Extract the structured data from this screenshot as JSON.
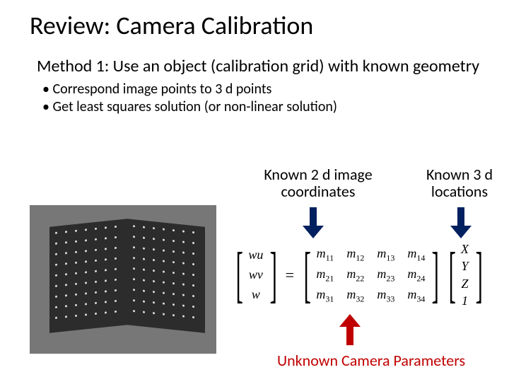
{
  "title": "Review: Camera Calibration",
  "method": "Method 1: Use an object (calibration grid) with known geometry",
  "bullets": {
    "b1": "Correspond image points to 3 d points",
    "b2": "Get least squares solution (or non-linear solution)"
  },
  "labels": {
    "k2d_a": "Known 2 d image",
    "k2d_b": "coordinates",
    "k3d_a": "Known 3 d",
    "k3d_b": "locations"
  },
  "eq": {
    "lhs": {
      "r1": "wu",
      "r2": "wv",
      "r3": "w"
    },
    "m": {
      "r1c1": "m",
      "s11": "11",
      "r1c2": "m",
      "s12": "12",
      "r1c3": "m",
      "s13": "13",
      "r1c4": "m",
      "s14": "14",
      "r2c1": "m",
      "s21": "21",
      "r2c2": "m",
      "s22": "22",
      "r2c3": "m",
      "s23": "23",
      "r2c4": "m",
      "s24": "24",
      "r3c1": "m",
      "s31": "31",
      "r3c2": "m",
      "s32": "32",
      "r3c3": "m",
      "s33": "33",
      "r3c4": "m",
      "s34": "34"
    },
    "rhs": {
      "r1": "X",
      "r2": "Y",
      "r3": "Z",
      "r4": "1"
    },
    "equals": "="
  },
  "caption": "Unknown Camera Parameters"
}
